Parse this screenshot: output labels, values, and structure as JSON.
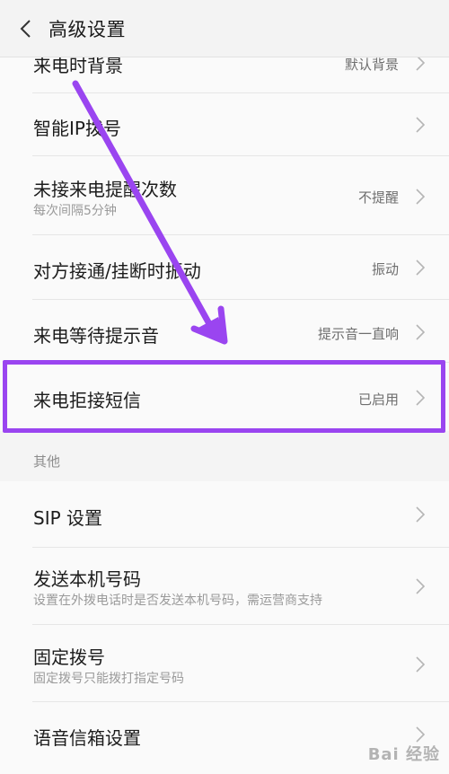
{
  "header": {
    "title": "高级设置",
    "back_icon": "chevron-left-icon"
  },
  "rows_top": [
    {
      "title": "来电时背景",
      "value": "默认背景"
    },
    {
      "title": "智能IP拨号",
      "value": ""
    },
    {
      "title": "未接来电提醒次数",
      "subtitle": "每次间隔5分钟",
      "value": "不提醒"
    },
    {
      "title": "对方接通/挂断时振动",
      "value": "振动"
    },
    {
      "title": "来电等待提示音",
      "value": "提示音一直响"
    },
    {
      "title": "来电拒接短信",
      "value": "已启用"
    }
  ],
  "section_other": {
    "label": "其他"
  },
  "rows_other": [
    {
      "title": "SIP 设置",
      "value": ""
    },
    {
      "title": "发送本机号码",
      "subtitle": "设置在外拨电话时是否发送本机号码，需运营商支持"
    },
    {
      "title": "固定拨号",
      "subtitle": "固定拨号只能拨打指定号码"
    },
    {
      "title": "语音信箱设置"
    }
  ],
  "annotation": {
    "highlight_color": "#9a45f0",
    "arrow_color": "#9a45f0"
  },
  "watermark": {
    "text": "Bai 经验"
  }
}
